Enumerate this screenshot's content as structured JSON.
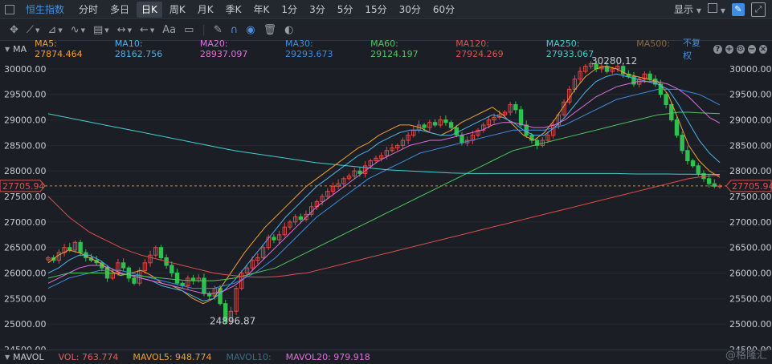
{
  "topbar": {
    "title": "恒生指数",
    "tabs": [
      "分时",
      "多日",
      "日K",
      "周K",
      "月K",
      "季K",
      "年K",
      "1分",
      "3分",
      "5分",
      "15分",
      "30分",
      "60分"
    ],
    "active_tab": "日K",
    "display_label": "显示"
  },
  "ma_bar": {
    "label": "MA",
    "items": [
      {
        "text": "MA5: 27874.464",
        "color": "#f0a030"
      },
      {
        "text": "MA10: 28162.756",
        "color": "#4fb0e8"
      },
      {
        "text": "MA20: 28937.097",
        "color": "#e070e0"
      },
      {
        "text": "MA30: 29293.673",
        "color": "#3a8ee6"
      },
      {
        "text": "MA60: 29124.197",
        "color": "#4cc860"
      },
      {
        "text": "MA120: 27924.269",
        "color": "#e05050"
      },
      {
        "text": "MA250: 27933.067",
        "color": "#40d0d0"
      },
      {
        "text": "MA500:",
        "color": "#8a6a40"
      }
    ],
    "adjust_label": "不复权"
  },
  "vol_bar": {
    "label": "MAVOL",
    "items": [
      {
        "text": "VOL: 763.774",
        "color": "#e06060"
      },
      {
        "text": "MAVOL5: 948.774",
        "color": "#f0a030"
      },
      {
        "text": "MAVOL10:",
        "color": "#3a6e8a"
      },
      {
        "text": "MAVOL20: 979.918",
        "color": "#e070e0"
      }
    ]
  },
  "watermark": "@格隆汇",
  "chart_data": {
    "type": "candlestick",
    "ylim": [
      24500,
      30250
    ],
    "y_ticks": [
      24500,
      25000,
      25500,
      26000,
      26500,
      27000,
      27500,
      28000,
      28500,
      29000,
      29500,
      30000
    ],
    "last_price": 27705.94,
    "last_price_label": "27705.94",
    "high_label": "30280.12",
    "low_label": "24896.87",
    "closes": [
      26300,
      26250,
      26400,
      26500,
      26450,
      26600,
      26400,
      26300,
      26250,
      26200,
      26100,
      25900,
      26000,
      26200,
      26100,
      25900,
      25800,
      26050,
      26200,
      26350,
      26500,
      26300,
      26150,
      26000,
      25800,
      25750,
      25900,
      25850,
      25900,
      25600,
      25550,
      25700,
      25400,
      25050,
      25250,
      25700,
      26000,
      26100,
      26250,
      26300,
      26500,
      26700,
      26650,
      26750,
      26900,
      27000,
      27100,
      27050,
      27150,
      27300,
      27400,
      27500,
      27600,
      27700,
      27750,
      27850,
      27900,
      28000,
      27950,
      28100,
      28200,
      28250,
      28300,
      28400,
      28450,
      28500,
      28600,
      28700,
      28800,
      28900,
      28850,
      28950,
      28900,
      29000,
      28950,
      28850,
      28700,
      28550,
      28600,
      28700,
      28800,
      28900,
      29000,
      29050,
      29100,
      29150,
      29300,
      29200,
      28900,
      28700,
      28600,
      28500,
      28600,
      28700,
      28900,
      29100,
      29350,
      29600,
      29800,
      29950,
      30050,
      30100,
      30000,
      30050,
      29950,
      30000,
      30050,
      29900,
      29850,
      29700,
      29800,
      29900,
      29800,
      29700,
      29500,
      29300,
      29000,
      28700,
      28400,
      28200,
      28100,
      27950,
      27850,
      27750,
      27700,
      27705.94
    ],
    "ma": {
      "ma5": [
        26200,
        26350,
        26450,
        26400,
        26300,
        26200,
        26050,
        25950,
        26000,
        26050,
        25950,
        25800,
        25750,
        25650,
        25500,
        25400,
        25500,
        25800,
        26100,
        26400,
        26650,
        26900,
        27100,
        27300,
        27500,
        27700,
        27850,
        28000,
        28150,
        28300,
        28450,
        28550,
        28700,
        28800,
        28900,
        28900,
        28850,
        28750,
        28700,
        28800,
        28950,
        29050,
        29150,
        29250,
        29100,
        28900,
        28700,
        28600,
        28750,
        29000,
        29300,
        29600,
        29850,
        30000,
        30050,
        30000,
        29900,
        29850,
        29800,
        29750,
        29500,
        29000,
        28500,
        28200,
        28000,
        27874
      ],
      "ma10": [
        26000,
        26100,
        26250,
        26350,
        26350,
        26250,
        26100,
        26000,
        25950,
        25900,
        25850,
        25750,
        25700,
        25650,
        25550,
        25450,
        25500,
        25650,
        25850,
        26100,
        26350,
        26600,
        26850,
        27100,
        27300,
        27500,
        27700,
        27850,
        28000,
        28150,
        28300,
        28400,
        28550,
        28650,
        28750,
        28800,
        28800,
        28750,
        28700,
        28700,
        28800,
        28900,
        29000,
        29100,
        29050,
        28950,
        28800,
        28700,
        28700,
        28850,
        29050,
        29300,
        29550,
        29750,
        29850,
        29900,
        29850,
        29800,
        29750,
        29700,
        29600,
        29300,
        28950,
        28600,
        28350,
        28163
      ],
      "ma20": [
        25800,
        25900,
        26000,
        26100,
        26150,
        26150,
        26100,
        26000,
        25950,
        25900,
        25850,
        25800,
        25750,
        25700,
        25650,
        25600,
        25600,
        25650,
        25750,
        25900,
        26100,
        26300,
        26500,
        26700,
        26900,
        27100,
        27300,
        27450,
        27600,
        27750,
        27900,
        28050,
        28200,
        28300,
        28400,
        28500,
        28550,
        28600,
        28600,
        28650,
        28700,
        28750,
        28800,
        28900,
        28950,
        28950,
        28900,
        28850,
        28850,
        28900,
        29000,
        29150,
        29300,
        29450,
        29550,
        29650,
        29700,
        29750,
        29750,
        29750,
        29700,
        29600,
        29450,
        29250,
        29050,
        28937
      ],
      "ma30": [
        25700,
        25800,
        25900,
        25950,
        26000,
        26050,
        26050,
        26050,
        26000,
        25950,
        25900,
        25850,
        25800,
        25750,
        25700,
        25700,
        25700,
        25750,
        25800,
        25900,
        26000,
        26150,
        26300,
        26500,
        26700,
        26900,
        27100,
        27250,
        27400,
        27550,
        27700,
        27850,
        27950,
        28050,
        28150,
        28250,
        28350,
        28400,
        28450,
        28500,
        28550,
        28600,
        28650,
        28700,
        28750,
        28800,
        28800,
        28800,
        28800,
        28850,
        28900,
        29000,
        29100,
        29200,
        29300,
        29400,
        29450,
        29500,
        29550,
        29600,
        29600,
        29600,
        29550,
        29500,
        29400,
        29294
      ],
      "ma60": [
        25900,
        25950,
        26000,
        26000,
        26000,
        26000,
        26000,
        25980,
        25960,
        25940,
        25920,
        25900,
        25880,
        25860,
        25850,
        25850,
        25850,
        25870,
        25900,
        25950,
        26000,
        26050,
        26100,
        26200,
        26300,
        26400,
        26500,
        26600,
        26700,
        26800,
        26900,
        27000,
        27100,
        27200,
        27300,
        27400,
        27500,
        27600,
        27700,
        27800,
        27900,
        28000,
        28100,
        28200,
        28300,
        28400,
        28450,
        28500,
        28550,
        28600,
        28650,
        28700,
        28750,
        28800,
        28850,
        28900,
        28950,
        29000,
        29050,
        29100,
        29120,
        29150,
        29150,
        29140,
        29130,
        29124
      ],
      "ma120": [
        27500,
        27300,
        27100,
        26950,
        26800,
        26700,
        26600,
        26500,
        26420,
        26350,
        26300,
        26250,
        26200,
        26150,
        26100,
        26050,
        26000,
        25970,
        25950,
        25930,
        25920,
        25920,
        25930,
        25950,
        25980,
        26000,
        26050,
        26100,
        26150,
        26200,
        26250,
        26300,
        26350,
        26400,
        26450,
        26500,
        26550,
        26600,
        26650,
        26700,
        26750,
        26800,
        26850,
        26900,
        26950,
        27000,
        27050,
        27100,
        27150,
        27200,
        27250,
        27300,
        27350,
        27400,
        27450,
        27500,
        27550,
        27600,
        27650,
        27700,
        27750,
        27800,
        27850,
        27880,
        27900,
        27924
      ],
      "ma250": [
        29120,
        29080,
        29040,
        29000,
        28960,
        28920,
        28880,
        28840,
        28800,
        28760,
        28720,
        28680,
        28640,
        28600,
        28560,
        28520,
        28480,
        28440,
        28400,
        28370,
        28340,
        28310,
        28280,
        28250,
        28220,
        28190,
        28160,
        28140,
        28120,
        28100,
        28080,
        28060,
        28040,
        28020,
        28010,
        28000,
        27990,
        27980,
        27970,
        27960,
        27955,
        27950,
        27950,
        27950,
        27950,
        27950,
        27950,
        27950,
        27950,
        27950,
        27950,
        27950,
        27950,
        27950,
        27950,
        27950,
        27945,
        27940,
        27940,
        27940,
        27940,
        27938,
        27936,
        27935,
        27934,
        27933
      ]
    }
  }
}
